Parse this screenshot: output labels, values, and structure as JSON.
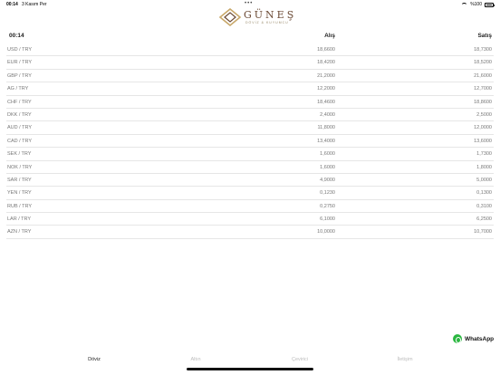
{
  "status_bar": {
    "time": "00:14",
    "date": "3 Kasım Per",
    "dots": "•••",
    "battery": "%100"
  },
  "logo": {
    "name": "GÜNEŞ",
    "subtitle": "DÖVİZ & KUYUMCU"
  },
  "table": {
    "time": "00:14",
    "buy_label": "Alış",
    "sell_label": "Satış",
    "rows": [
      {
        "pair": "USD / TRY",
        "buy": "18,6600",
        "sell": "18,7300"
      },
      {
        "pair": "EUR / TRY",
        "buy": "18,4200",
        "sell": "18,5200"
      },
      {
        "pair": "GBP / TRY",
        "buy": "21,2000",
        "sell": "21,6000"
      },
      {
        "pair": "AG / TRY",
        "buy": "12,2000",
        "sell": "12,7000"
      },
      {
        "pair": "CHF / TRY",
        "buy": "18,4600",
        "sell": "18,8600"
      },
      {
        "pair": "DKK / TRY",
        "buy": "2,4000",
        "sell": "2,5000"
      },
      {
        "pair": "AUD / TRY",
        "buy": "11,8000",
        "sell": "12,0000"
      },
      {
        "pair": "CAD / TRY",
        "buy": "13,4000",
        "sell": "13,6000"
      },
      {
        "pair": "SEK / TRY",
        "buy": "1,6000",
        "sell": "1,7300"
      },
      {
        "pair": "NOK / TRY",
        "buy": "1,6000",
        "sell": "1,8000"
      },
      {
        "pair": "SAR / TRY",
        "buy": "4,9000",
        "sell": "5,0000"
      },
      {
        "pair": "YEN / TRY",
        "buy": "0,1230",
        "sell": "0,1300"
      },
      {
        "pair": "RUB / TRY",
        "buy": "0,2750",
        "sell": "0,3100"
      },
      {
        "pair": "LAR / TRY",
        "buy": "6,1000",
        "sell": "6,2500"
      },
      {
        "pair": "AZN / TRY",
        "buy": "10,0000",
        "sell": "10,7000"
      }
    ]
  },
  "whatsapp": {
    "label": "WhatsApp",
    "icon": "whatsapp-icon",
    "color": "#2bb741"
  },
  "tabs": [
    {
      "label": "Döviz",
      "active": true
    },
    {
      "label": "Altın",
      "active": false
    },
    {
      "label": "Çevirici",
      "active": false
    },
    {
      "label": "İletişim",
      "active": false
    }
  ],
  "colors": {
    "logo_brown": "#6b4a35",
    "logo_gold": "#c8a86a",
    "active_tab": "#222222",
    "inactive_tab": "#bdbdbd"
  }
}
